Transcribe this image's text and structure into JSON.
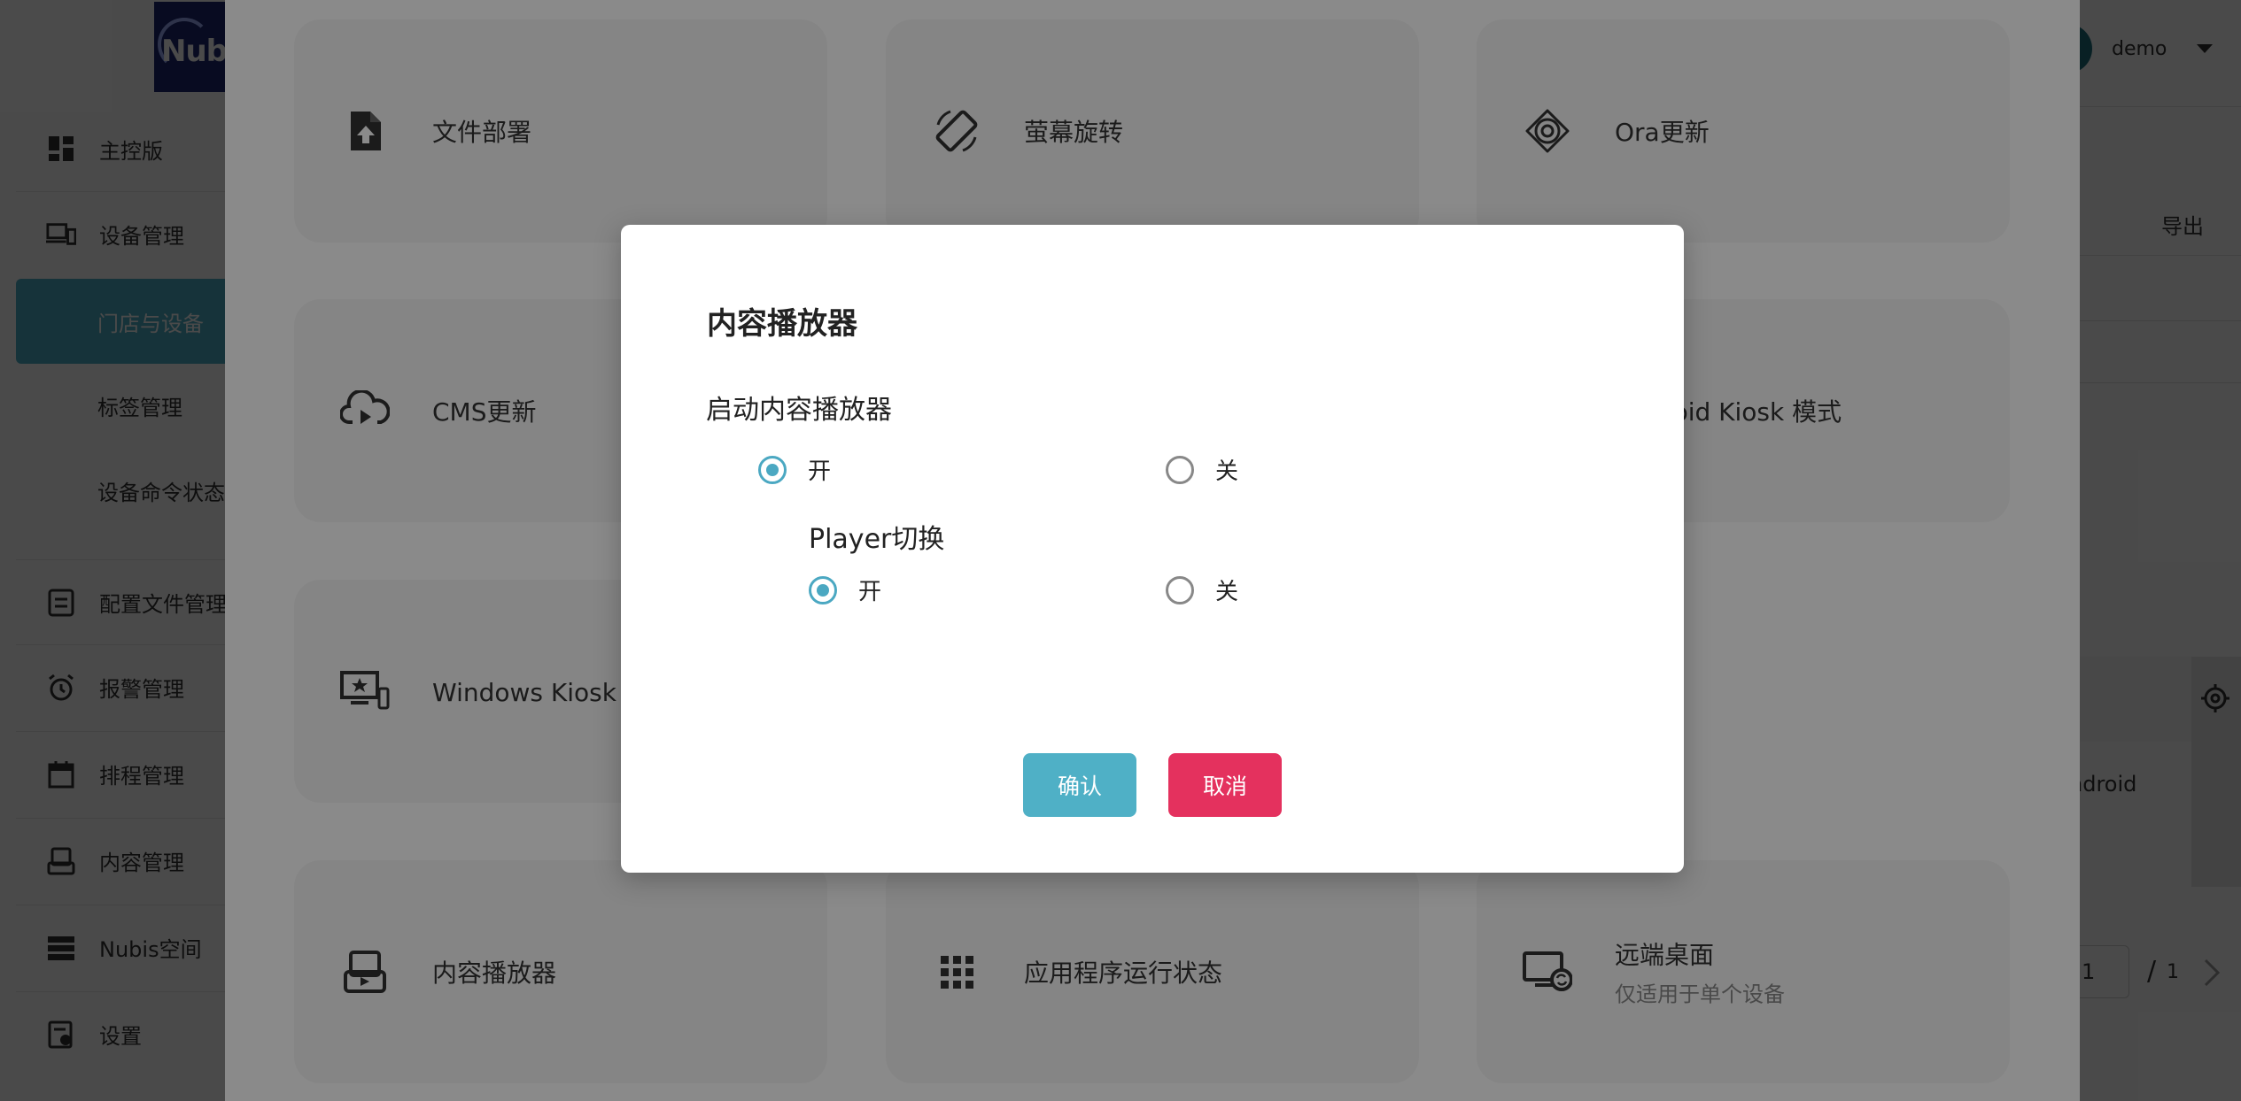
{
  "app": {
    "logo_text": "Nubi",
    "user_name": "demo",
    "export_label": "导出",
    "table_os_value": "ndroid",
    "pager": {
      "current": "1",
      "separator": "/",
      "total": "1"
    }
  },
  "sidebar": {
    "items": [
      {
        "label": "主控版",
        "icon": "dashboard-icon"
      },
      {
        "label": "设备管理",
        "icon": "devices-icon"
      },
      {
        "label": "门店与设备"
      },
      {
        "label": "标签管理"
      },
      {
        "label": "设备命令状态"
      },
      {
        "label": "配置文件管理",
        "icon": "config-file-icon"
      },
      {
        "label": "报警管理",
        "icon": "alarm-icon"
      },
      {
        "label": "排程管理",
        "icon": "calendar-icon"
      },
      {
        "label": "内容管理",
        "icon": "content-icon"
      },
      {
        "label": "Nubis空间",
        "icon": "storage-icon"
      },
      {
        "label": "设置",
        "icon": "settings-doc-icon"
      }
    ]
  },
  "commands": [
    {
      "label": "文件部署",
      "icon": "file-upload-icon"
    },
    {
      "label": "萤幕旋转",
      "icon": "screen-rotate-icon"
    },
    {
      "label": "Ora更新",
      "icon": "ora-update-icon"
    },
    {
      "label": "CMS更新",
      "icon": "cloud-play-icon"
    },
    {
      "label": "Android Kiosk 模式",
      "icon": "android-kiosk-icon"
    },
    {
      "label": "Windows Kiosk 模式",
      "icon": "windows-kiosk-icon"
    },
    {
      "label": "内容播放器",
      "icon": "content-player-icon"
    },
    {
      "label": "应用程序运行状态",
      "icon": "app-grid-icon"
    },
    {
      "label": "远端桌面",
      "sub": "仅适用于单个设备",
      "icon": "remote-desktop-icon"
    }
  ],
  "dialog": {
    "title": "内容播放器",
    "section1": {
      "label": "启动内容播放器",
      "options": [
        {
          "label": "开",
          "checked": true
        },
        {
          "label": "关",
          "checked": false
        }
      ]
    },
    "section2": {
      "label": "Player切换",
      "options": [
        {
          "label": "开",
          "checked": true
        },
        {
          "label": "关",
          "checked": false
        }
      ]
    },
    "confirm_label": "确认",
    "cancel_label": "取消"
  },
  "colors": {
    "accent": "#4fb0c6",
    "danger": "#e4315e",
    "logo_bg": "#1c2a72",
    "card_bg": "#f6f6f6"
  }
}
